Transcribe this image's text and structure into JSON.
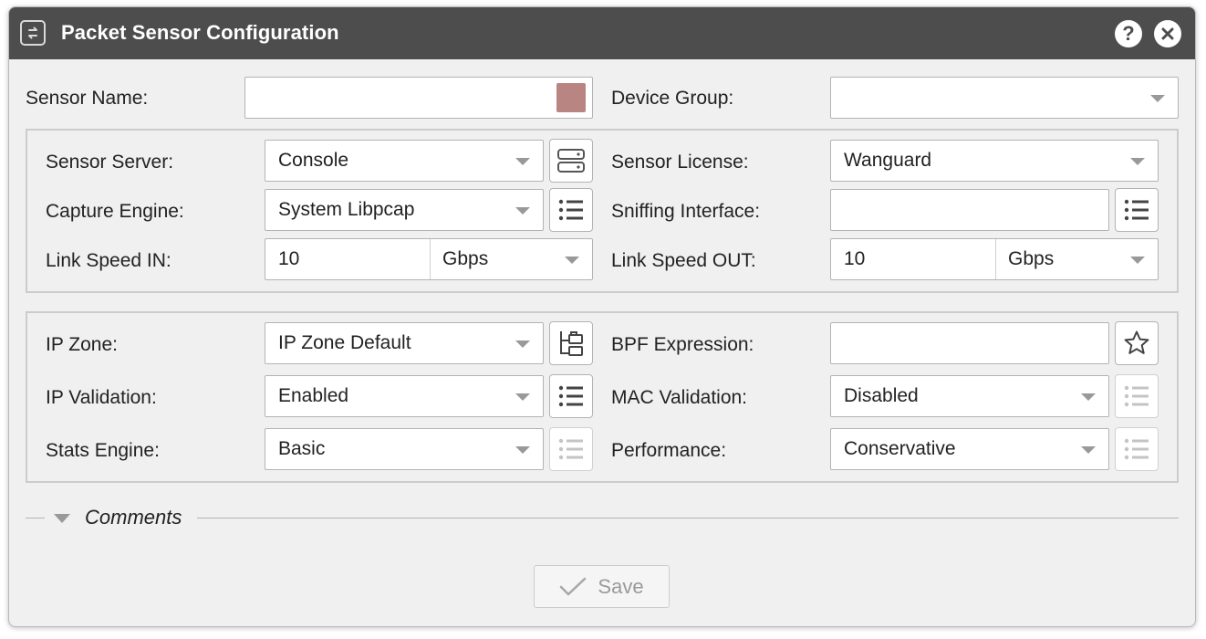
{
  "window": {
    "title": "Packet Sensor Configuration",
    "help_icon": "question-mark-icon",
    "close_icon": "close-icon"
  },
  "top_row": {
    "sensor_name_label": "Sensor Name:",
    "sensor_name_value": "",
    "sensor_color": "#b98582",
    "device_group_label": "Device Group:",
    "device_group_value": ""
  },
  "sensor_group": {
    "sensor_server_label": "Sensor Server:",
    "sensor_server_value": "Console",
    "sensor_license_label": "Sensor License:",
    "sensor_license_value": "Wanguard",
    "capture_engine_label": "Capture Engine:",
    "capture_engine_value": "System Libpcap",
    "sniffing_interface_label": "Sniffing Interface:",
    "sniffing_interface_value": "",
    "link_speed_in_label": "Link Speed IN:",
    "link_speed_in_value": "10",
    "link_speed_in_unit": "Gbps",
    "link_speed_out_label": "Link Speed OUT:",
    "link_speed_out_value": "10",
    "link_speed_out_unit": "Gbps"
  },
  "ip_group": {
    "ip_zone_label": "IP Zone:",
    "ip_zone_value": "IP Zone Default",
    "bpf_expression_label": "BPF Expression:",
    "bpf_expression_value": "",
    "ip_validation_label": "IP Validation:",
    "ip_validation_value": "Enabled",
    "mac_validation_label": "MAC Validation:",
    "mac_validation_value": "Disabled",
    "stats_engine_label": "Stats Engine:",
    "stats_engine_value": "Basic",
    "performance_label": "Performance:",
    "performance_value": "Conservative"
  },
  "comments": {
    "label": "Comments"
  },
  "footer": {
    "save_label": "Save"
  },
  "colors": {
    "titlebar": "#4d4d4d",
    "panel": "#f0f0f0",
    "disabled_text": "#9a9a9a"
  }
}
